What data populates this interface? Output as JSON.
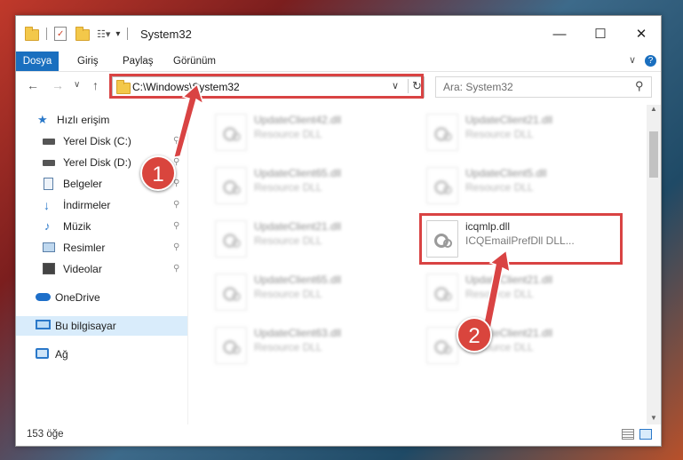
{
  "window": {
    "title": "System32",
    "minimize_glyph": "—",
    "maximize_glyph": "☐",
    "close_glyph": "✕"
  },
  "ribbon": {
    "tabs": [
      "Dosya",
      "Giriş",
      "Paylaş",
      "Görünüm"
    ],
    "collapse_glyph": "∨",
    "help_glyph": "?"
  },
  "nav": {
    "back_glyph": "←",
    "forward_glyph": "→",
    "recent_glyph": "∨",
    "up_glyph": "↑",
    "address": "C:\\Windows\\System32",
    "address_dropdown_glyph": "∨",
    "refresh_glyph": "↻",
    "search_placeholder": "Ara: System32",
    "search_glyph": "⚲"
  },
  "sidebar": {
    "items": [
      {
        "label": "Hızlı erişim",
        "icon": "star-icon",
        "pinned": false
      },
      {
        "label": "Yerel Disk (C:)",
        "icon": "drive-icon",
        "pinned": true
      },
      {
        "label": "Yerel Disk (D:)",
        "icon": "drive-icon",
        "pinned": true
      },
      {
        "label": "Belgeler",
        "icon": "document-icon",
        "pinned": true
      },
      {
        "label": "İndirmeler",
        "icon": "download-icon",
        "pinned": true
      },
      {
        "label": "Müzik",
        "icon": "music-icon",
        "pinned": true
      },
      {
        "label": "Resimler",
        "icon": "pictures-icon",
        "pinned": true
      },
      {
        "label": "Videolar",
        "icon": "video-icon",
        "pinned": true
      },
      {
        "label": "OneDrive",
        "icon": "cloud-icon",
        "pinned": false
      },
      {
        "label": "Bu bilgisayar",
        "icon": "computer-icon",
        "pinned": false
      },
      {
        "label": "Ağ",
        "icon": "network-icon",
        "pinned": false
      }
    ],
    "pin_glyph": "📌"
  },
  "files": [
    {
      "name": "UpdateClient42.dll",
      "desc": "Resource DLL"
    },
    {
      "name": "UpdateClient21.dll",
      "desc": "Resource DLL"
    },
    {
      "name": "UpdateClient65.dll",
      "desc": "Resource DLL"
    },
    {
      "name": "UpdateClient5.dll",
      "desc": "Resource DLL"
    },
    {
      "name": "UpdateClient21.dll",
      "desc": "Resource DLL"
    },
    {
      "name": "icqmlp.dll",
      "desc": "ICQEmailPrefDll DLL..."
    },
    {
      "name": "UpdateClient65.dll",
      "desc": "Resource DLL"
    },
    {
      "name": "UpdateClient21.dll",
      "desc": "Resource DLL"
    },
    {
      "name": "UpdateClient63.dll",
      "desc": "Resource DLL"
    },
    {
      "name": "UpdateClient21.dll",
      "desc": "Resource DLL"
    }
  ],
  "status": {
    "count": "153 öğe"
  },
  "annotations": {
    "step1": "1",
    "step2": "2"
  },
  "colors": {
    "accent": "#1a6fbf",
    "highlight": "#d94343",
    "selected_bg": "#d9ecfb"
  }
}
